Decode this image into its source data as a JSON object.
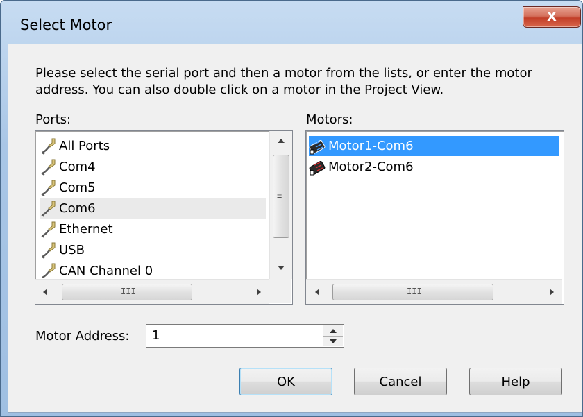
{
  "window": {
    "title": "Select Motor",
    "close_label": "X"
  },
  "instructions": "Please select the serial port and then a motor from the lists, or enter the motor address.  You can also double click on a motor in the Project View.",
  "ports": {
    "label": "Ports:",
    "items": [
      "All Ports",
      "Com4",
      "Com5",
      "Com6",
      "Ethernet",
      "USB",
      "CAN Channel 0"
    ],
    "hovered": "Com6"
  },
  "motors": {
    "label": "Motors:",
    "items": [
      "Motor1-Com6",
      "Motor2-Com6"
    ],
    "selected": "Motor1-Com6"
  },
  "address": {
    "label": "Motor Address:",
    "value": "1"
  },
  "buttons": {
    "ok": "OK",
    "cancel": "Cancel",
    "help": "Help"
  },
  "scroll": {
    "grip_v": "≡",
    "grip_h": "III"
  },
  "colors": {
    "selection": "#3399ff",
    "title_bar": "#a9c6e6",
    "close_button": "#c23e28"
  }
}
